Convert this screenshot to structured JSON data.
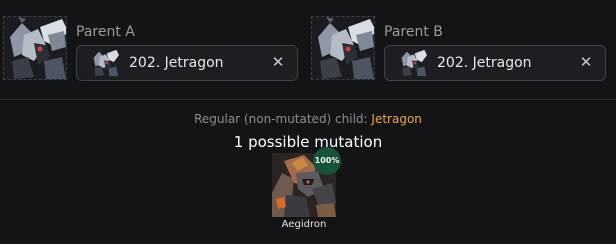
{
  "parent_a": {
    "label": "Parent A",
    "selected": "202. Jetragon",
    "clear_icon": "close-icon"
  },
  "parent_b": {
    "label": "Parent B",
    "selected": "202. Jetragon",
    "clear_icon": "close-icon"
  },
  "regular_child": {
    "prefix": "Regular (non-mutated) child:",
    "name": "Jetragon"
  },
  "mutations": {
    "count_text": "1 possible mutation",
    "results": [
      {
        "name": "Aegidron",
        "chance": "100%"
      }
    ]
  },
  "colors": {
    "background": "#131416",
    "accent_orange": "#f0a63a",
    "badge_green": "#16543a"
  }
}
